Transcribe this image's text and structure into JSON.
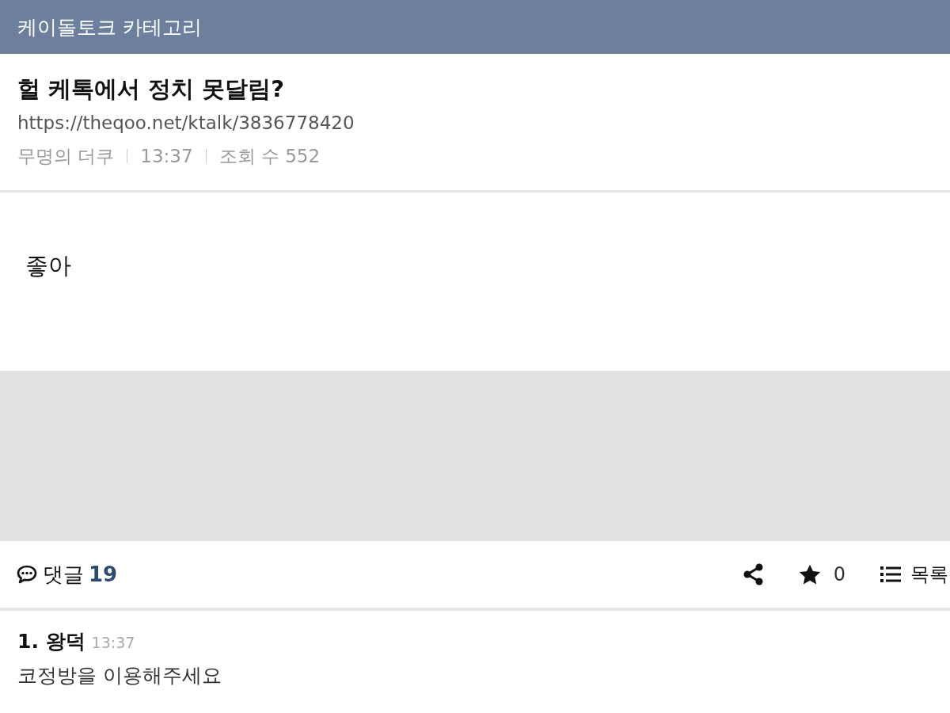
{
  "header": {
    "title": "케이돌토크 카테고리"
  },
  "post": {
    "title": "헐 케톡에서 정치 못달림?",
    "url": "https://theqoo.net/ktalk/3836778420",
    "author": "무명의 더쿠",
    "time": "13:37",
    "views": "조회 수 552",
    "body": "좋아"
  },
  "actions": {
    "comments_label": "댓글",
    "comments_count": "19",
    "stars": "0",
    "list_label": "목록"
  },
  "comments": [
    {
      "number": "1.",
      "author": "왕덕",
      "time": "13:37",
      "text": "코정방을 이용해주세요"
    }
  ]
}
